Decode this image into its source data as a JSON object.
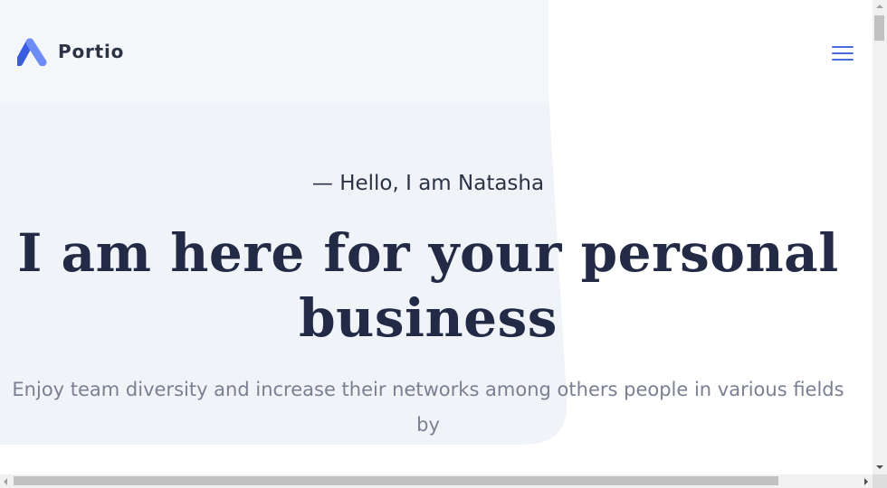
{
  "brand": {
    "name": "Portio",
    "accent": "#5b7cf0"
  },
  "header": {
    "menu_icon": "hamburger-menu-icon"
  },
  "hero": {
    "greeting": "— Hello, I am Natasha",
    "headline": "I am here for your personal business",
    "subtext": "Enjoy team diversity and increase their networks among others people in various fields by"
  },
  "colors": {
    "background_shape": "#f0f4f8",
    "header_band": "#f4f7fa",
    "headline": "#222a45",
    "body_text": "#7a7f92"
  }
}
